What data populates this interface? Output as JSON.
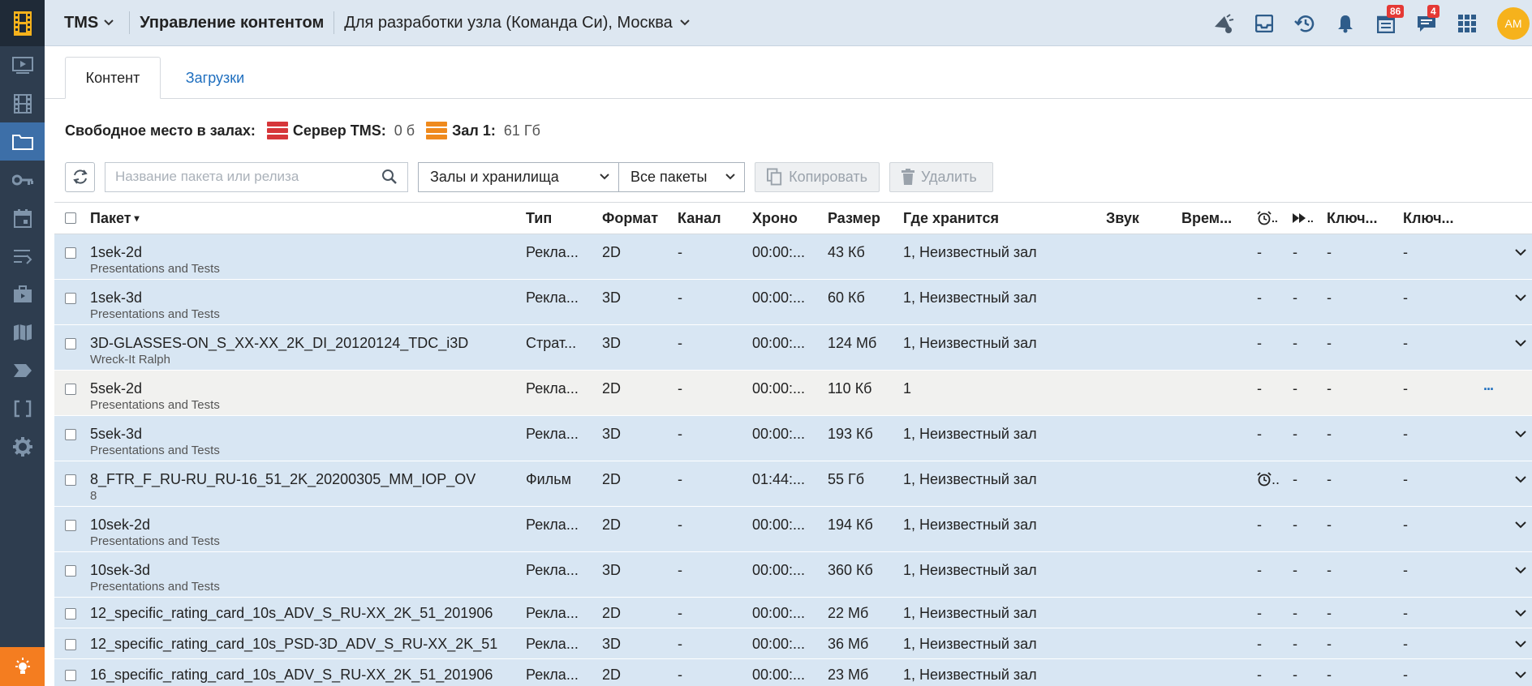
{
  "sidebar": {
    "items": [
      "film-strip-icon",
      "play-screen-icon",
      "film-icon",
      "folder-icon",
      "key-icon",
      "calendar-icon",
      "list-icon",
      "briefcase-icon",
      "map-icon",
      "tag-icon",
      "brackets-icon",
      "gear-icon"
    ],
    "bottom": "lightbulb-icon"
  },
  "topbar": {
    "brand": "TMS",
    "title": "Управление контентом",
    "context": "Для разработки узла (Команда Си), Москва",
    "badges": {
      "calendar": "86",
      "chat": "4"
    },
    "avatar": "AM"
  },
  "tabs": {
    "content": "Контент",
    "uploads": "Загрузки"
  },
  "freespace": {
    "label": "Свободное место в залах:",
    "server_label": "Сервер TMS:",
    "server_value": "0 б",
    "hall_label": "Зал 1:",
    "hall_value": "61 Гб"
  },
  "toolbar": {
    "search_placeholder": "Название пакета или релиза",
    "halls_select": "Залы и хранилища",
    "packages_select": "Все пакеты",
    "copy_label": "Копировать",
    "delete_label": "Удалить"
  },
  "columns": {
    "package": "Пакет",
    "sort": "▾",
    "type": "Тип",
    "format": "Формат",
    "channel": "Канал",
    "duration": "Хроно",
    "size": "Размер",
    "location": "Где хранится",
    "sound": "Звук",
    "time": "Врем...",
    "forward": "..",
    "key1": "Ключ...",
    "key2": "Ключ..."
  },
  "rows": [
    {
      "name": "1sek-2d",
      "sub": "Presentations and Tests",
      "type": "Рекла...",
      "format": "2D",
      "channel": "-",
      "duration": "00:00:...",
      "size": "43 Кб",
      "location": "1, Неизвестный зал",
      "c1": "-",
      "c2": "-",
      "c3": "-",
      "c4": "-"
    },
    {
      "name": "1sek-3d",
      "sub": "Presentations and Tests",
      "type": "Рекла...",
      "format": "3D",
      "channel": "-",
      "duration": "00:00:...",
      "size": "60 Кб",
      "location": "1, Неизвестный зал",
      "c1": "-",
      "c2": "-",
      "c3": "-",
      "c4": "-"
    },
    {
      "name": "3D-GLASSES-ON_S_XX-XX_2K_DI_20120124_TDC_i3D",
      "sub": "Wreck-It Ralph",
      "type": "Страт...",
      "format": "3D",
      "channel": "-",
      "duration": "00:00:...",
      "size": "124 Мб",
      "location": "1, Неизвестный зал",
      "c1": "-",
      "c2": "-",
      "c3": "-",
      "c4": "-"
    },
    {
      "name": "5sek-2d",
      "sub": "Presentations and Tests",
      "type": "Рекла...",
      "format": "2D",
      "channel": "-",
      "duration": "00:00:...",
      "size": "110 Кб",
      "location": "1",
      "c1": "-",
      "c2": "-",
      "c3": "-",
      "c4": "-",
      "more": "...",
      "hover": true
    },
    {
      "name": "5sek-3d",
      "sub": "Presentations and Tests",
      "type": "Рекла...",
      "format": "3D",
      "channel": "-",
      "duration": "00:00:...",
      "size": "193 Кб",
      "location": "1, Неизвестный зал",
      "c1": "-",
      "c2": "-",
      "c3": "-",
      "c4": "-"
    },
    {
      "name": "8_FTR_F_RU-RU_RU-16_51_2K_20200305_MM_IOP_OV",
      "sub": "8",
      "type": "Фильм",
      "format": "2D",
      "channel": "-",
      "duration": "01:44:...",
      "size": "55 Гб",
      "location": "1, Неизвестный зал",
      "c1": "..",
      "c2": "-",
      "c3": "-",
      "c4": "-",
      "alarm": true
    },
    {
      "name": "10sek-2d",
      "sub": "Presentations and Tests",
      "type": "Рекла...",
      "format": "2D",
      "channel": "-",
      "duration": "00:00:...",
      "size": "194 Кб",
      "location": "1, Неизвестный зал",
      "c1": "-",
      "c2": "-",
      "c3": "-",
      "c4": "-"
    },
    {
      "name": "10sek-3d",
      "sub": "Presentations and Tests",
      "type": "Рекла...",
      "format": "3D",
      "channel": "-",
      "duration": "00:00:...",
      "size": "360 Кб",
      "location": "1, Неизвестный зал",
      "c1": "-",
      "c2": "-",
      "c3": "-",
      "c4": "-"
    },
    {
      "name": "12_specific_rating_card_10s_ADV_S_RU-XX_2K_51_201906",
      "sub": "",
      "type": "Рекла...",
      "format": "2D",
      "channel": "-",
      "duration": "00:00:...",
      "size": "22 Мб",
      "location": "1, Неизвестный зал",
      "c1": "-",
      "c2": "-",
      "c3": "-",
      "c4": "-"
    },
    {
      "name": "12_specific_rating_card_10s_PSD-3D_ADV_S_RU-XX_2K_51",
      "sub": "",
      "type": "Рекла...",
      "format": "3D",
      "channel": "-",
      "duration": "00:00:...",
      "size": "36 Мб",
      "location": "1, Неизвестный зал",
      "c1": "-",
      "c2": "-",
      "c3": "-",
      "c4": "-"
    },
    {
      "name": "16_specific_rating_card_10s_ADV_S_RU-XX_2K_51_201906",
      "sub": "",
      "type": "Рекла...",
      "format": "2D",
      "channel": "-",
      "duration": "00:00:...",
      "size": "23 Мб",
      "location": "1, Неизвестный зал",
      "c1": "-",
      "c2": "-",
      "c3": "-",
      "c4": "-"
    }
  ],
  "colors": {
    "sidebar": "#2e3d4f",
    "accent": "#3d6fa8",
    "selected_row": "#d8e6f3",
    "link": "#1f6fbf",
    "badge": "#e53935",
    "avatar": "#f6b21c",
    "bottom": "#f47d20"
  }
}
